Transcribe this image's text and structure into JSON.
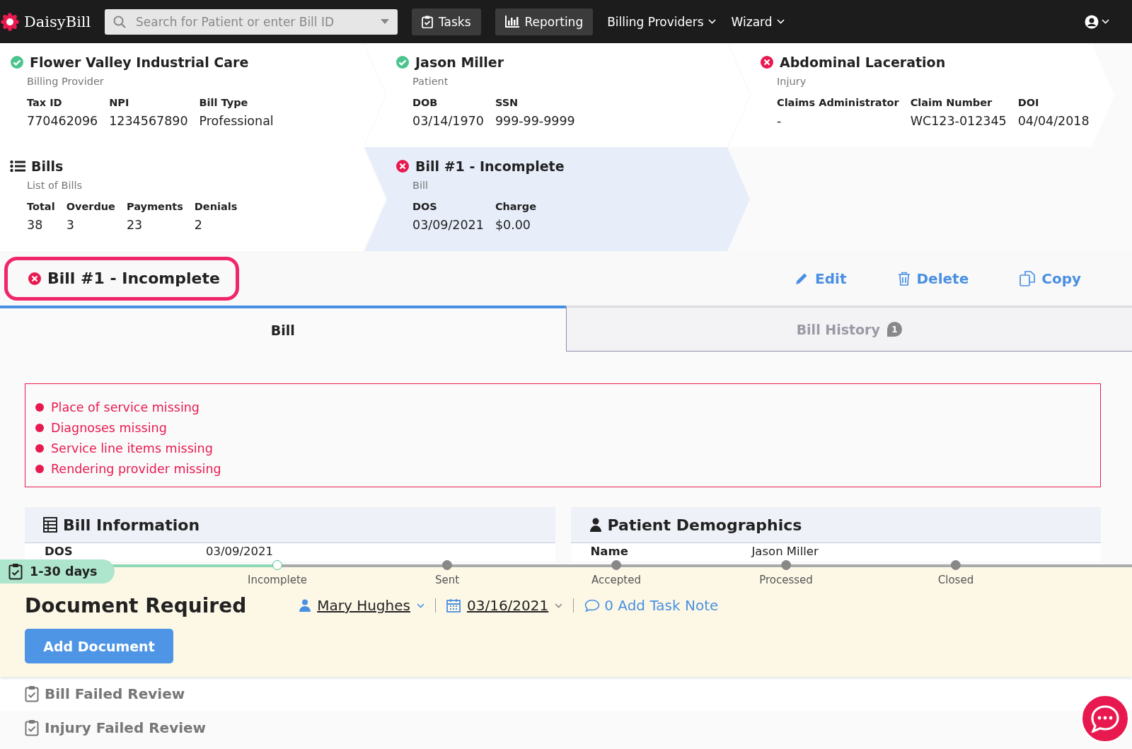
{
  "topbar": {
    "logo": "DaisyBill",
    "search": {
      "placeholder": "Search for Patient or enter Bill ID"
    },
    "nav": [
      {
        "label": "Tasks",
        "kind": "button"
      },
      {
        "label": "Reporting",
        "kind": "button"
      },
      {
        "label": "Billing Providers",
        "kind": "menu"
      },
      {
        "label": "Wizard",
        "kind": "menu"
      }
    ]
  },
  "cards": [
    [
      {
        "kind": "complete",
        "title": "Flower Valley Industrial Care",
        "subtitle": "Billing Provider",
        "selected": false,
        "fields": [
          {
            "label": "Tax ID",
            "value": "770462096"
          },
          {
            "label": "NPI",
            "value": "1234567890"
          },
          {
            "label": "Bill Type",
            "value": "Professional"
          }
        ]
      },
      {
        "kind": "complete",
        "title": "Jason Miller",
        "subtitle": "Patient",
        "selected": false,
        "fields": [
          {
            "label": "DOB",
            "value": "03/14/1970"
          },
          {
            "label": "SSN",
            "value": "999-99-9999"
          }
        ]
      },
      {
        "kind": "incomplete",
        "title": "Abdominal Laceration",
        "subtitle": "Injury",
        "selected": false,
        "fields": [
          {
            "label": "Claims Administrator",
            "value": "-"
          },
          {
            "label": "Claim Number",
            "value": "WC123-012345"
          },
          {
            "label": "DOI",
            "value": "04/04/2018"
          }
        ]
      }
    ],
    [
      {
        "kind": "list",
        "title": "Bills",
        "subtitle": "List of Bills",
        "selected": false,
        "fields": [
          {
            "label": "Total",
            "value": "38"
          },
          {
            "label": "Overdue",
            "value": "3"
          },
          {
            "label": "Payments",
            "value": "23"
          },
          {
            "label": "Denials",
            "value": "2"
          }
        ]
      },
      {
        "kind": "incomplete",
        "title": "Bill #1 - Incomplete",
        "subtitle": "Bill",
        "selected": true,
        "fields": [
          {
            "label": "DOS",
            "value": "03/09/2021"
          },
          {
            "label": "Charge",
            "value": "$0.00"
          }
        ]
      }
    ]
  ],
  "bill": {
    "kind": "incomplete",
    "title": "Bill #1 - Incomplete",
    "highlighted": true,
    "actions": [
      "Edit",
      "Delete",
      "Copy"
    ]
  },
  "tabs": [
    {
      "label": "Bill",
      "selected": true
    },
    {
      "label": "Bill History",
      "selected": false,
      "badge": "1"
    }
  ],
  "errors": [
    "Place of service missing",
    "Diagnoses missing",
    "Service line items missing",
    "Rendering provider missing"
  ],
  "sections": [
    {
      "title": "Bill Information",
      "rows": [
        {
          "label": "DOS",
          "value": "03/09/2021"
        }
      ]
    },
    {
      "title": "Patient Demographics",
      "rows": [
        {
          "label": "Name",
          "value": "Jason Miller"
        }
      ]
    }
  ],
  "task": {
    "age": "1-30 days",
    "steps": [
      {
        "label": "Incomplete",
        "reached": true
      },
      {
        "label": "Sent",
        "reached": false
      },
      {
        "label": "Accepted",
        "reached": false
      },
      {
        "label": "Processed",
        "reached": false
      },
      {
        "label": "Closed",
        "reached": false
      }
    ],
    "title": "Document Required",
    "assignee": "Mary Hughes",
    "due": "03/16/2021",
    "note": "0 Add Task Note",
    "button": "Add Document"
  },
  "other_tasks": [
    "Bill Failed Review",
    "Injury Failed Review"
  ]
}
